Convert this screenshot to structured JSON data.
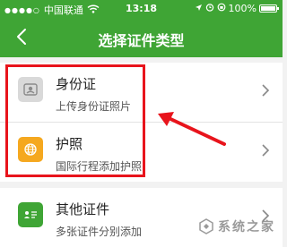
{
  "status_bar": {
    "carrier": "中国联通",
    "time": "13:18",
    "battery": "100%",
    "battery_level": 1.0
  },
  "nav": {
    "title": "选择证件类型",
    "back_icon": "chevron-left-icon"
  },
  "items": [
    {
      "name": "身份证",
      "desc": "上传身份证照片",
      "icon": "id-card-icon",
      "icon_bg": "#d9d9d9",
      "icon_fg": "#8a8a8a"
    },
    {
      "name": "护照",
      "desc": "国际行程添加护照",
      "icon": "globe-icon",
      "icon_bg": "#f5a81f",
      "icon_fg": "#ffffff"
    },
    {
      "name": "其他证件",
      "desc": "多张证件分别添加",
      "icon": "card-icon",
      "icon_bg": "#3fa535",
      "icon_fg": "#ffffff"
    }
  ],
  "annotation": {
    "highlight_color": "#e8141c"
  },
  "watermark": {
    "text": "系统之家"
  },
  "colors": {
    "primary_green": "#3fa535",
    "background": "#f2f2f2"
  }
}
